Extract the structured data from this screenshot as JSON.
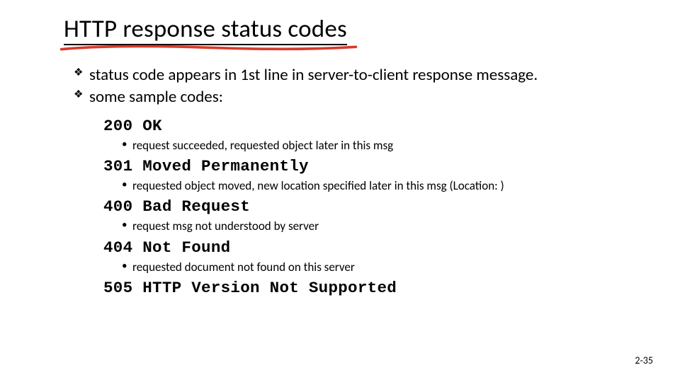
{
  "title": "HTTP response status codes",
  "bullets": [
    "status code appears in 1st line in server-to-client response message.",
    "some sample codes:"
  ],
  "codes": [
    {
      "line": "200 OK",
      "desc": "request succeeded, requested object later in this msg"
    },
    {
      "line": "301 Moved Permanently",
      "desc": "requested object moved, new location specified later in this msg (Location: )"
    },
    {
      "line": "400 Bad Request",
      "desc": "request msg not understood by server"
    },
    {
      "line": "404 Not Found",
      "desc": "requested document not found on this server"
    },
    {
      "line": "505 HTTP Version Not Supported",
      "desc": ""
    }
  ],
  "slide_number": "2-35"
}
